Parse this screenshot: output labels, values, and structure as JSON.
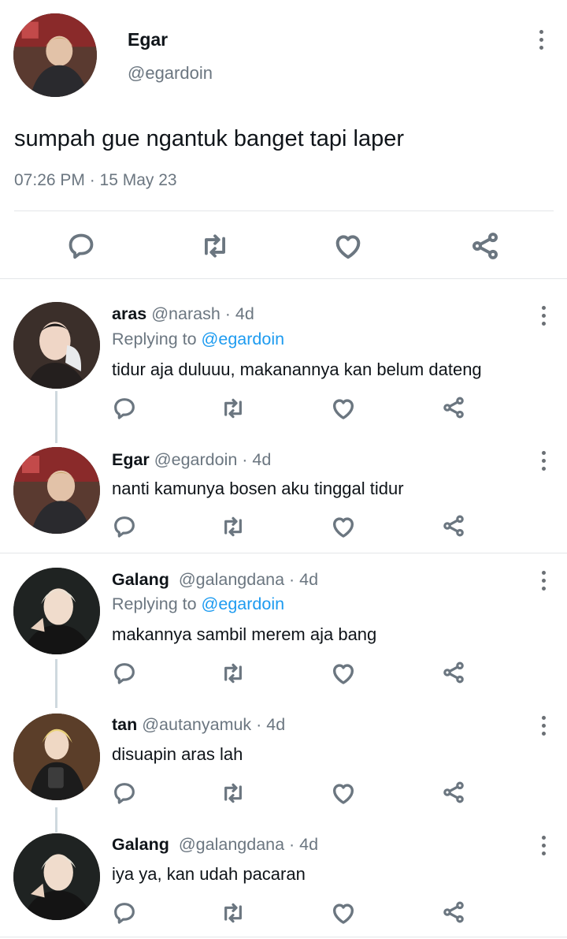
{
  "tweet": {
    "name": "Egar",
    "handle": "@egardoin",
    "text": "sumpah gue ngantuk banget tapi laper",
    "timestamp": "07:26 PM · 15 May 23"
  },
  "replies": [
    {
      "name": "aras",
      "handle": "@narash",
      "meta": " · 4d",
      "replying_label": "Replying to ",
      "replying_to": "@egardoin",
      "text": "tidur aja duluuu, makanannya kan belum dateng"
    },
    {
      "name": "Egar",
      "handle": "@egardoin",
      "meta": " · 4d",
      "text": "nanti kamunya bosen aku tinggal tidur"
    },
    {
      "name": "Galang",
      "handle": "@galangdana",
      "meta": " · 4d",
      "replying_label": "Replying to ",
      "replying_to": "@egardoin",
      "text": "makannya sambil merem aja bang"
    },
    {
      "name": "tan",
      "handle": "@autanyamuk",
      "meta": " · 4d",
      "text": "disuapin aras lah"
    },
    {
      "name": "Galang",
      "handle": "@galangdana",
      "meta": " · 4d",
      "text": "iya ya, kan udah pacaran"
    }
  ],
  "colors": {
    "mention": "#1d9bf0",
    "secondary_text": "#6b7680",
    "divider": "#e3e6e8"
  },
  "icons": [
    "reply-icon",
    "retweet-icon",
    "like-icon",
    "share-icon",
    "more-icon"
  ]
}
